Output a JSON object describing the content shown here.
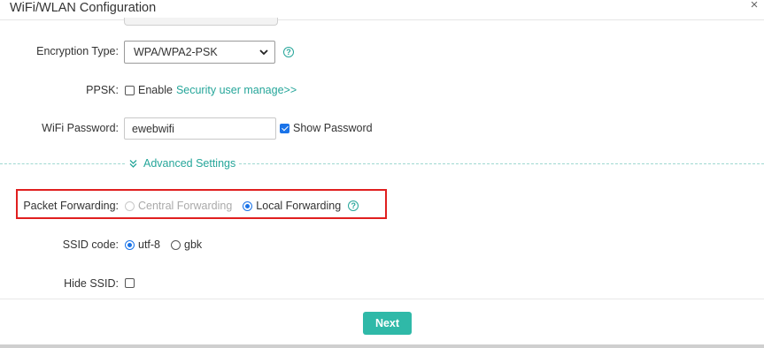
{
  "dialog": {
    "title": "WiFi/WLAN Configuration",
    "close_glyph": "×"
  },
  "encryption": {
    "label": "Encryption Type:",
    "selected": "WPA/WPA2-PSK",
    "help_icon": "question-circle-icon"
  },
  "ppsk": {
    "label": "PPSK:",
    "checked": false,
    "option_label": "Enable",
    "link": "Security user manage>>"
  },
  "password": {
    "label": "WiFi Password:",
    "value": "ewebwifi",
    "show_checked": true,
    "show_label": "Show Password"
  },
  "advanced": {
    "label": "Advanced Settings",
    "icon": "double-chevron-down-icon"
  },
  "forwarding": {
    "label": "Packet Forwarding:",
    "options": [
      {
        "label": "Central Forwarding",
        "selected": false,
        "disabled": true
      },
      {
        "label": "Local Forwarding",
        "selected": true,
        "disabled": false
      }
    ],
    "help_icon": "question-circle-icon"
  },
  "ssid_code": {
    "label": "SSID code:",
    "options": [
      {
        "label": "utf-8",
        "selected": true
      },
      {
        "label": "gbk",
        "selected": false
      }
    ]
  },
  "hide_ssid": {
    "label": "Hide SSID:",
    "checked": false
  },
  "footer": {
    "next_label": "Next"
  },
  "colors": {
    "accent": "#26a69a",
    "button": "#2fb9a8",
    "selected": "#1a73e8",
    "highlight_border": "#e01f1f"
  }
}
